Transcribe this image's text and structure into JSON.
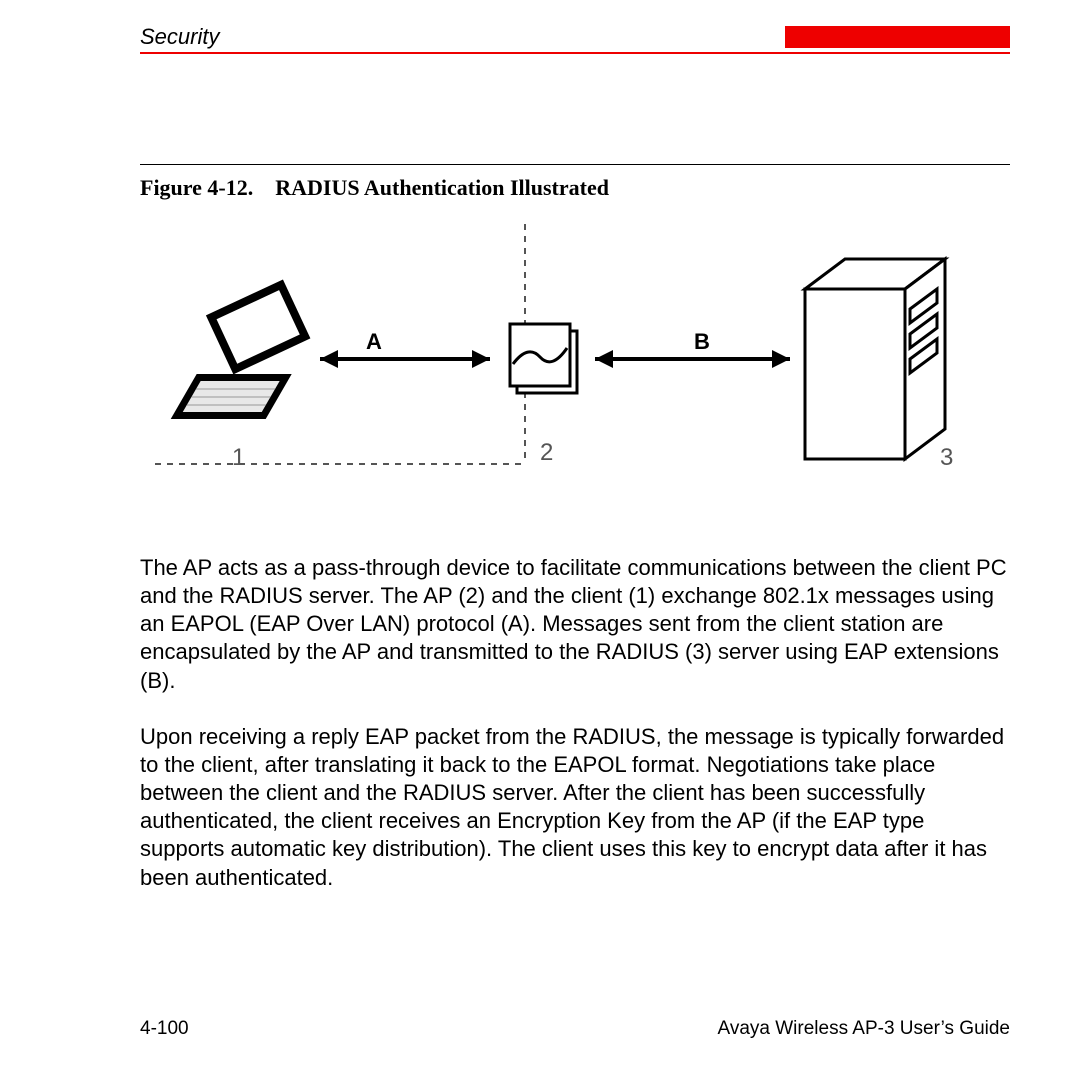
{
  "header": {
    "section": "Security"
  },
  "figure": {
    "label": "Figure 4-12.",
    "title": "RADIUS Authentication Illustrated",
    "labels": {
      "A": "A",
      "B": "B",
      "n1": "1",
      "n2": "2",
      "n3": "3"
    }
  },
  "paragraphs": {
    "p1": "The AP acts as a pass-through device to facilitate communications between the client PC and the RADIUS server. The AP (2) and the client (1) exchange 802.1x messages using an EAPOL (EAP Over LAN) protocol (A). Messages sent from the client station are encapsulated by the AP and transmitted to the RADIUS (3) server using EAP extensions (B).",
    "p2": "Upon receiving a reply EAP packet from the RADIUS, the message is typically forwarded to the client, after translating it back to the EAPOL format. Negotiations take place between the client and the RADIUS server. After the client has been successfully authenticated, the client receives an Encryption Key from the AP (if the EAP type supports automatic key distribution). The client uses this key to encrypt data after it has been authenticated."
  },
  "footer": {
    "page": "4-100",
    "book": "Avaya Wireless AP-3 User’s Guide"
  }
}
